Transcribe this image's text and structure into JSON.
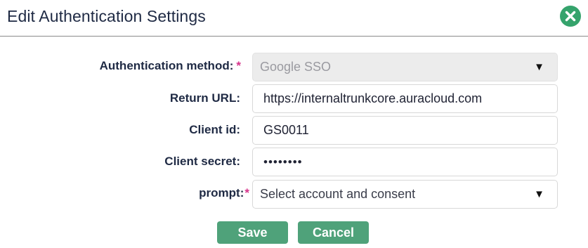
{
  "dialog": {
    "title": "Edit Authentication Settings",
    "close_icon": "close-circle-icon"
  },
  "form": {
    "auth_method": {
      "label": "Authentication method:",
      "required_marker": "*",
      "value": "Google SSO",
      "disabled": true
    },
    "return_url": {
      "label": "Return URL:",
      "value": "https://internaltrunkcore.auracloud.com"
    },
    "client_id": {
      "label": "Client id:",
      "value": "GS0011"
    },
    "client_secret": {
      "label": "Client secret:",
      "value": "••••••••"
    },
    "prompt": {
      "label": "prompt:",
      "required_marker": "*",
      "value": "Select account and consent"
    },
    "dropdown_caret": "▼"
  },
  "buttons": {
    "save": "Save",
    "cancel": "Cancel"
  },
  "colors": {
    "accent": "#4fa27a",
    "close": "#35a36c",
    "required": "#d6338a",
    "text": "#1f2a44"
  }
}
